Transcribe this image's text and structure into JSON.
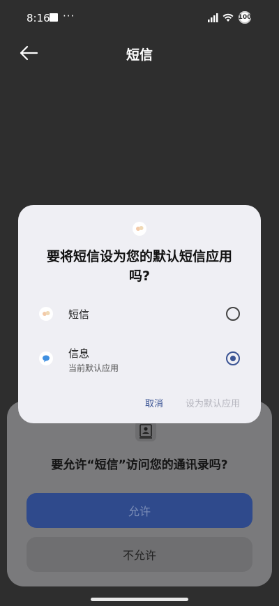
{
  "status_bar": {
    "time": "8:16",
    "dots": "···",
    "battery": "100"
  },
  "header": {
    "title": "短信"
  },
  "dialog": {
    "title": "要将短信设为您的默认短信应用吗?",
    "options": [
      {
        "label": "短信",
        "sublabel": "",
        "selected": false,
        "icon": "sms-app-icon"
      },
      {
        "label": "信息",
        "sublabel": "当前默认应用",
        "selected": true,
        "icon": "messages-app-icon"
      }
    ],
    "cancel_label": "取消",
    "set_default_label": "设为默认应用"
  },
  "permission_sheet": {
    "icon": "contacts-icon",
    "question": "要允许“短信”访问您的通讯录吗?",
    "allow_label": "允许",
    "deny_label": "不允许"
  },
  "colors": {
    "accent": "#3b5494",
    "dialog_bg": "#efeff4",
    "backdrop": "#2e2e2e"
  }
}
